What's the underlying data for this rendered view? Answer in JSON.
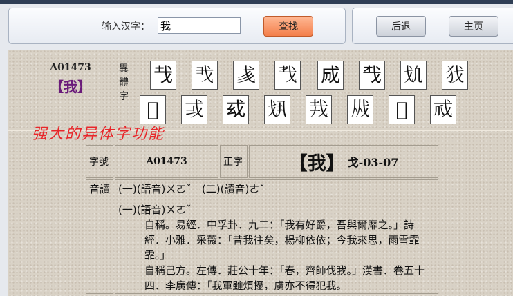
{
  "toolbar": {
    "search_label": "输入汉字：",
    "search_value": "我",
    "search_button": "查找",
    "back_button": "后退",
    "home_button": "主页"
  },
  "entry": {
    "code": "A01473",
    "char_display": "【我】",
    "variant_label": "異體字",
    "variants_row1": [
      "𢦏",
      "𢦐",
      "𢦑",
      "𢦒",
      "𢦓",
      "𢦔",
      "𢦕",
      "𢦖"
    ],
    "variants_row2": [
      "𢦗",
      "𢦘",
      "𢦙",
      "𢦚",
      "𢦛",
      "𢦜",
      "𢦝",
      "𢦞"
    ],
    "promo_text": "强大的异体字功能"
  },
  "table": {
    "label_code": "字號",
    "code_value": "A01473",
    "label_zheng": "正字",
    "zheng_char": "【我】",
    "radical": "戈-03-07",
    "label_pron": "音讀",
    "pron_text": "(一)(語音)ㄨㄛˇ　(二)(讀音)ㄜˇ",
    "def_head": "(一)(語音)ㄨㄛˇ",
    "def_text1": "自稱。易經．中孚卦．九二：「我有好爵，吾與爾靡之。」詩經．小雅．采薇：「昔我往矣，楊柳依依；今我來思，雨雪霏霏。」",
    "def_text2": "自稱己方。左傳．莊公十年：「春，齊師伐我。」漢書．卷五十四．李廣傳：「我軍雖煩擾，虜亦不得犯我。"
  }
}
